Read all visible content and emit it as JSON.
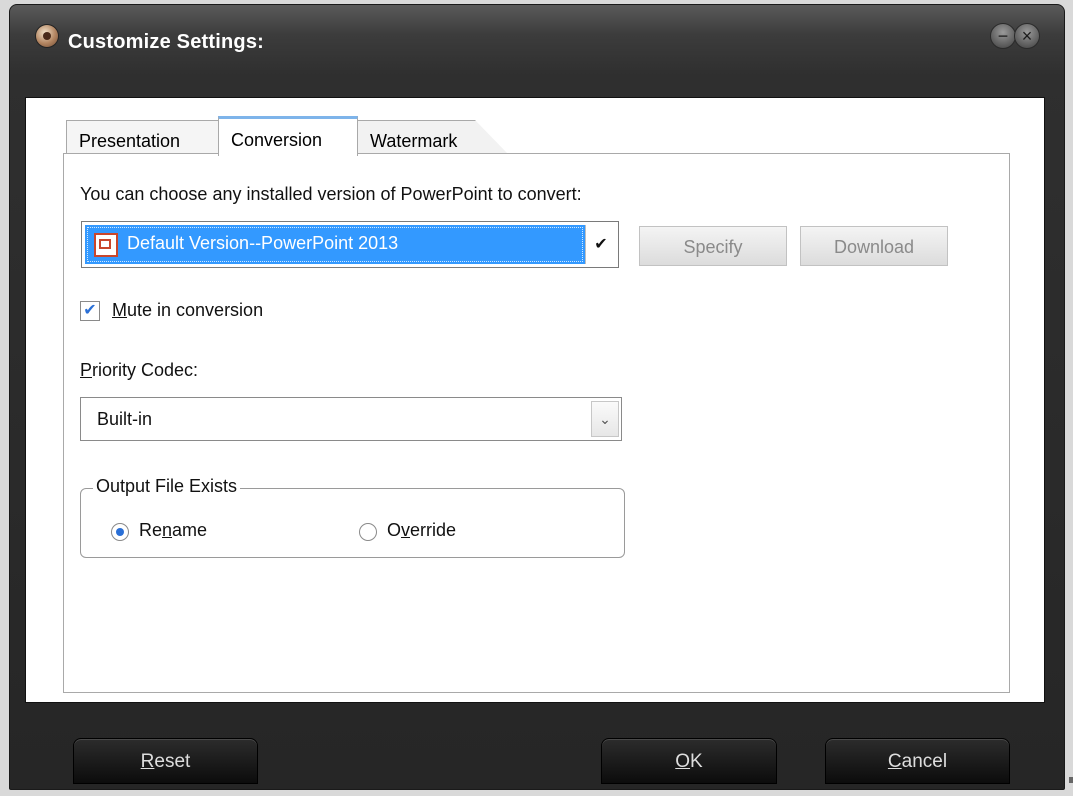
{
  "window": {
    "title": "Customize Settings:",
    "app_icon": "app-logo-icon",
    "minimize_glyph": "−",
    "close_glyph": "×"
  },
  "tabs": [
    {
      "label": "Presentation",
      "active": false
    },
    {
      "label": "Conversion",
      "active": true
    },
    {
      "label": "Watermark",
      "active": false
    }
  ],
  "conversion": {
    "prompt": "You can choose any installed version of PowerPoint to convert:",
    "version_select": {
      "value": "Default Version--PowerPoint 2013",
      "icon": "powerpoint-icon",
      "arrow_glyph": "✔"
    },
    "specify_label": "Specify",
    "download_label": "Download",
    "mute": {
      "checked": true,
      "check_glyph": "✔",
      "label_underlined": "M",
      "label_rest": "ute in conversion"
    },
    "priority_codec": {
      "label_underlined": "P",
      "label_rest": "riority Codec:",
      "value": "Built-in",
      "arrow_glyph": "⌄"
    },
    "output_file_exists": {
      "title": "Output File Exists",
      "options": [
        {
          "pre": "Re",
          "underlined": "n",
          "post": "ame",
          "checked": true
        },
        {
          "pre": "O",
          "underlined": "v",
          "post": "erride",
          "checked": false
        }
      ]
    }
  },
  "footer": {
    "reset": {
      "underlined": "R",
      "rest": "eset"
    },
    "ok": {
      "underlined": "O",
      "rest": "K"
    },
    "cancel": {
      "underlined": "C",
      "rest": "ancel"
    }
  },
  "colors": {
    "selection": "#3399ff",
    "active_tab_accent": "#7eb4ea",
    "checkbox_mark": "#2a6fd6",
    "frame_dark": "#262626"
  }
}
